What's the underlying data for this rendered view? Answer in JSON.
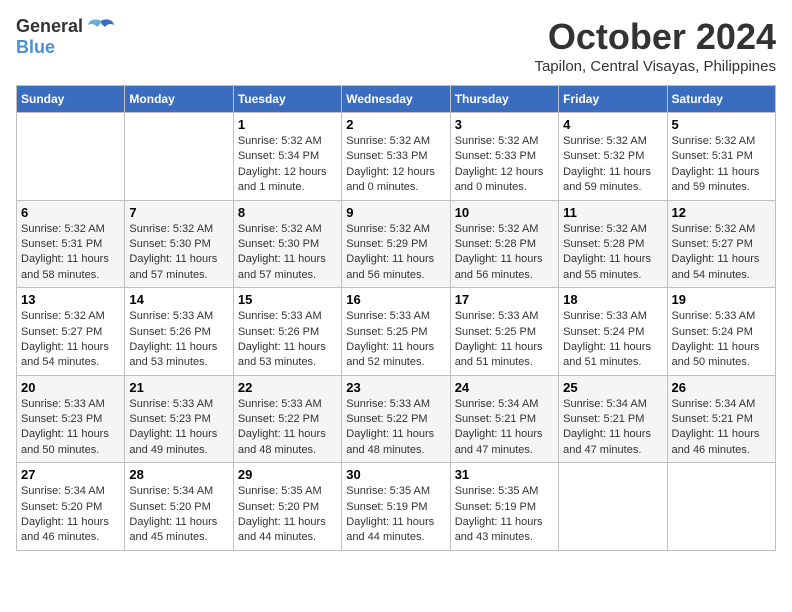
{
  "header": {
    "logo_general": "General",
    "logo_blue": "Blue",
    "month": "October 2024",
    "location": "Tapilon, Central Visayas, Philippines"
  },
  "weekdays": [
    "Sunday",
    "Monday",
    "Tuesday",
    "Wednesday",
    "Thursday",
    "Friday",
    "Saturday"
  ],
  "weeks": [
    [
      {
        "day": "",
        "info": ""
      },
      {
        "day": "",
        "info": ""
      },
      {
        "day": "1",
        "info": "Sunrise: 5:32 AM\nSunset: 5:34 PM\nDaylight: 12 hours\nand 1 minute."
      },
      {
        "day": "2",
        "info": "Sunrise: 5:32 AM\nSunset: 5:33 PM\nDaylight: 12 hours\nand 0 minutes."
      },
      {
        "day": "3",
        "info": "Sunrise: 5:32 AM\nSunset: 5:33 PM\nDaylight: 12 hours\nand 0 minutes."
      },
      {
        "day": "4",
        "info": "Sunrise: 5:32 AM\nSunset: 5:32 PM\nDaylight: 11 hours\nand 59 minutes."
      },
      {
        "day": "5",
        "info": "Sunrise: 5:32 AM\nSunset: 5:31 PM\nDaylight: 11 hours\nand 59 minutes."
      }
    ],
    [
      {
        "day": "6",
        "info": "Sunrise: 5:32 AM\nSunset: 5:31 PM\nDaylight: 11 hours\nand 58 minutes."
      },
      {
        "day": "7",
        "info": "Sunrise: 5:32 AM\nSunset: 5:30 PM\nDaylight: 11 hours\nand 57 minutes."
      },
      {
        "day": "8",
        "info": "Sunrise: 5:32 AM\nSunset: 5:30 PM\nDaylight: 11 hours\nand 57 minutes."
      },
      {
        "day": "9",
        "info": "Sunrise: 5:32 AM\nSunset: 5:29 PM\nDaylight: 11 hours\nand 56 minutes."
      },
      {
        "day": "10",
        "info": "Sunrise: 5:32 AM\nSunset: 5:28 PM\nDaylight: 11 hours\nand 56 minutes."
      },
      {
        "day": "11",
        "info": "Sunrise: 5:32 AM\nSunset: 5:28 PM\nDaylight: 11 hours\nand 55 minutes."
      },
      {
        "day": "12",
        "info": "Sunrise: 5:32 AM\nSunset: 5:27 PM\nDaylight: 11 hours\nand 54 minutes."
      }
    ],
    [
      {
        "day": "13",
        "info": "Sunrise: 5:32 AM\nSunset: 5:27 PM\nDaylight: 11 hours\nand 54 minutes."
      },
      {
        "day": "14",
        "info": "Sunrise: 5:33 AM\nSunset: 5:26 PM\nDaylight: 11 hours\nand 53 minutes."
      },
      {
        "day": "15",
        "info": "Sunrise: 5:33 AM\nSunset: 5:26 PM\nDaylight: 11 hours\nand 53 minutes."
      },
      {
        "day": "16",
        "info": "Sunrise: 5:33 AM\nSunset: 5:25 PM\nDaylight: 11 hours\nand 52 minutes."
      },
      {
        "day": "17",
        "info": "Sunrise: 5:33 AM\nSunset: 5:25 PM\nDaylight: 11 hours\nand 51 minutes."
      },
      {
        "day": "18",
        "info": "Sunrise: 5:33 AM\nSunset: 5:24 PM\nDaylight: 11 hours\nand 51 minutes."
      },
      {
        "day": "19",
        "info": "Sunrise: 5:33 AM\nSunset: 5:24 PM\nDaylight: 11 hours\nand 50 minutes."
      }
    ],
    [
      {
        "day": "20",
        "info": "Sunrise: 5:33 AM\nSunset: 5:23 PM\nDaylight: 11 hours\nand 50 minutes."
      },
      {
        "day": "21",
        "info": "Sunrise: 5:33 AM\nSunset: 5:23 PM\nDaylight: 11 hours\nand 49 minutes."
      },
      {
        "day": "22",
        "info": "Sunrise: 5:33 AM\nSunset: 5:22 PM\nDaylight: 11 hours\nand 48 minutes."
      },
      {
        "day": "23",
        "info": "Sunrise: 5:33 AM\nSunset: 5:22 PM\nDaylight: 11 hours\nand 48 minutes."
      },
      {
        "day": "24",
        "info": "Sunrise: 5:34 AM\nSunset: 5:21 PM\nDaylight: 11 hours\nand 47 minutes."
      },
      {
        "day": "25",
        "info": "Sunrise: 5:34 AM\nSunset: 5:21 PM\nDaylight: 11 hours\nand 47 minutes."
      },
      {
        "day": "26",
        "info": "Sunrise: 5:34 AM\nSunset: 5:21 PM\nDaylight: 11 hours\nand 46 minutes."
      }
    ],
    [
      {
        "day": "27",
        "info": "Sunrise: 5:34 AM\nSunset: 5:20 PM\nDaylight: 11 hours\nand 46 minutes."
      },
      {
        "day": "28",
        "info": "Sunrise: 5:34 AM\nSunset: 5:20 PM\nDaylight: 11 hours\nand 45 minutes."
      },
      {
        "day": "29",
        "info": "Sunrise: 5:35 AM\nSunset: 5:20 PM\nDaylight: 11 hours\nand 44 minutes."
      },
      {
        "day": "30",
        "info": "Sunrise: 5:35 AM\nSunset: 5:19 PM\nDaylight: 11 hours\nand 44 minutes."
      },
      {
        "day": "31",
        "info": "Sunrise: 5:35 AM\nSunset: 5:19 PM\nDaylight: 11 hours\nand 43 minutes."
      },
      {
        "day": "",
        "info": ""
      },
      {
        "day": "",
        "info": ""
      }
    ]
  ]
}
